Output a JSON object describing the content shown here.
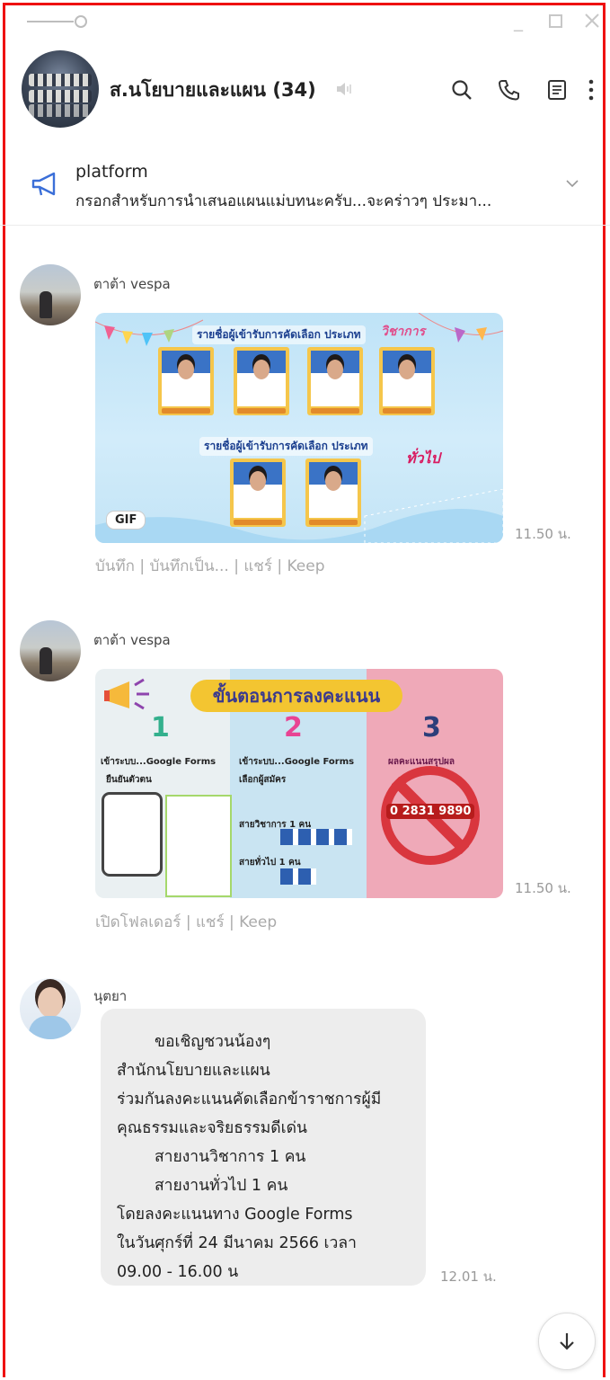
{
  "header": {
    "group_name": "ส.นโยบายและแผน (34)"
  },
  "announcement": {
    "title": "platform",
    "text": "กรอกสำหรับการนำเสนอแผนแม่บทนะครับ...จะคร่าวๆ ประมา..."
  },
  "messages": [
    {
      "sender": "ตาต้า vespa",
      "type": "image",
      "badge": "GIF",
      "time": "11.50 น.",
      "actions": "บันทึก | บันทึกเป็น... | แชร์ | Keep"
    },
    {
      "sender": "ตาต้า vespa",
      "type": "image",
      "time": "11.50 น.",
      "actions": "เปิดโฟลเดอร์ | แชร์ | Keep"
    },
    {
      "sender": "นุตยา",
      "type": "text",
      "time": "12.01 น.",
      "lines": [
        "ขอเชิญชวนน้องๆ",
        "สำนักนโยบายและแผน",
        "ร่วมกันลงคะแนนคัดเลือกข้าราชการผู้มี",
        "คุณธรรมและจริยธรรมดีเด่น",
        "สายงานวิชาการ 1 คน",
        "สายงานทั่วไป 1 คน",
        "โดยลงคะแนนทาง Google Forms",
        "ในวันศุกร์ที่ 24 มีนาคม 2566 เวลา",
        "09.00 - 16.00 น"
      ]
    }
  ],
  "image1": {
    "title_top": "รายชื่อผู้เข้ารับการคัดเลือก ประเภท",
    "tag_top": "วิชาการ",
    "title_bottom": "รายชื่อผู้เข้ารับการคัดเลือก ประเภท",
    "tag_bottom": "ทั่วไป"
  },
  "image2": {
    "banner": "ขั้นตอนการลงคะแนน",
    "step1_num": "1",
    "step1_label": "เข้าระบบ...Google Forms",
    "step1_sub": "ยืนยันตัวตน",
    "step2_num": "2",
    "step2_label": "เข้าระบบ...Google Forms",
    "step2_sub": "เลือกผู้สมัคร",
    "step2_row1": "สายวิชาการ 1 คน",
    "step2_row2": "สายทั่วไป 1 คน",
    "step3_num": "3",
    "step3_label": "ผลคะแนนสรุปผล",
    "step3_phone": "0 2831 9890"
  },
  "colors": {
    "frame": "#e11111",
    "accent": "#3b6fd8",
    "bubble": "#ededed"
  }
}
